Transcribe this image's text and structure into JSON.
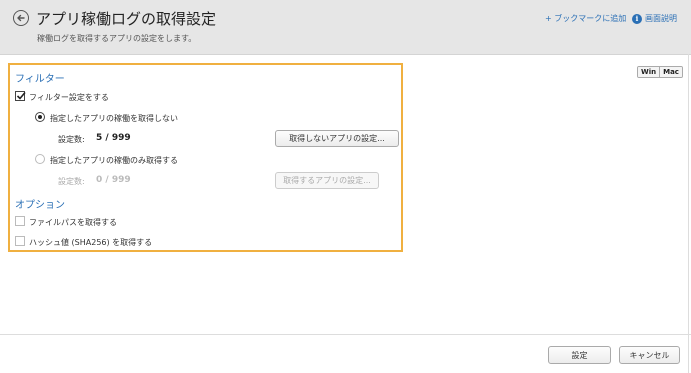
{
  "header": {
    "title": "アプリ稼働ログの取得設定",
    "subtitle": "稼働ログを取得するアプリの設定をします。",
    "bookmark_link": "+ ブックマークに追加",
    "help_link": "画面説明"
  },
  "os_toggle": {
    "win": "Win",
    "mac": "Mac"
  },
  "filter": {
    "section_title": "フィルター",
    "enable_checkbox": {
      "label": "フィルター設定をする",
      "checked": true
    },
    "option_exclude": {
      "label": "指定したアプリの稼働を取得しない",
      "selected": true,
      "count_label": "設定数:",
      "count_value": "5 / 999",
      "button_label": "取得しないアプリの設定..."
    },
    "option_include": {
      "label": "指定したアプリの稼働のみ取得する",
      "selected": false,
      "count_label": "設定数:",
      "count_value": "0 / 999",
      "button_label": "取得するアプリの設定..."
    }
  },
  "options": {
    "section_title": "オプション",
    "filepath_checkbox": {
      "label": "ファイルパスを取得する",
      "checked": false
    },
    "hash_checkbox": {
      "label": "ハッシュ値 (SHA256) を取得する",
      "checked": false
    }
  },
  "footer": {
    "ok_label": "設定",
    "cancel_label": "キャンセル"
  }
}
